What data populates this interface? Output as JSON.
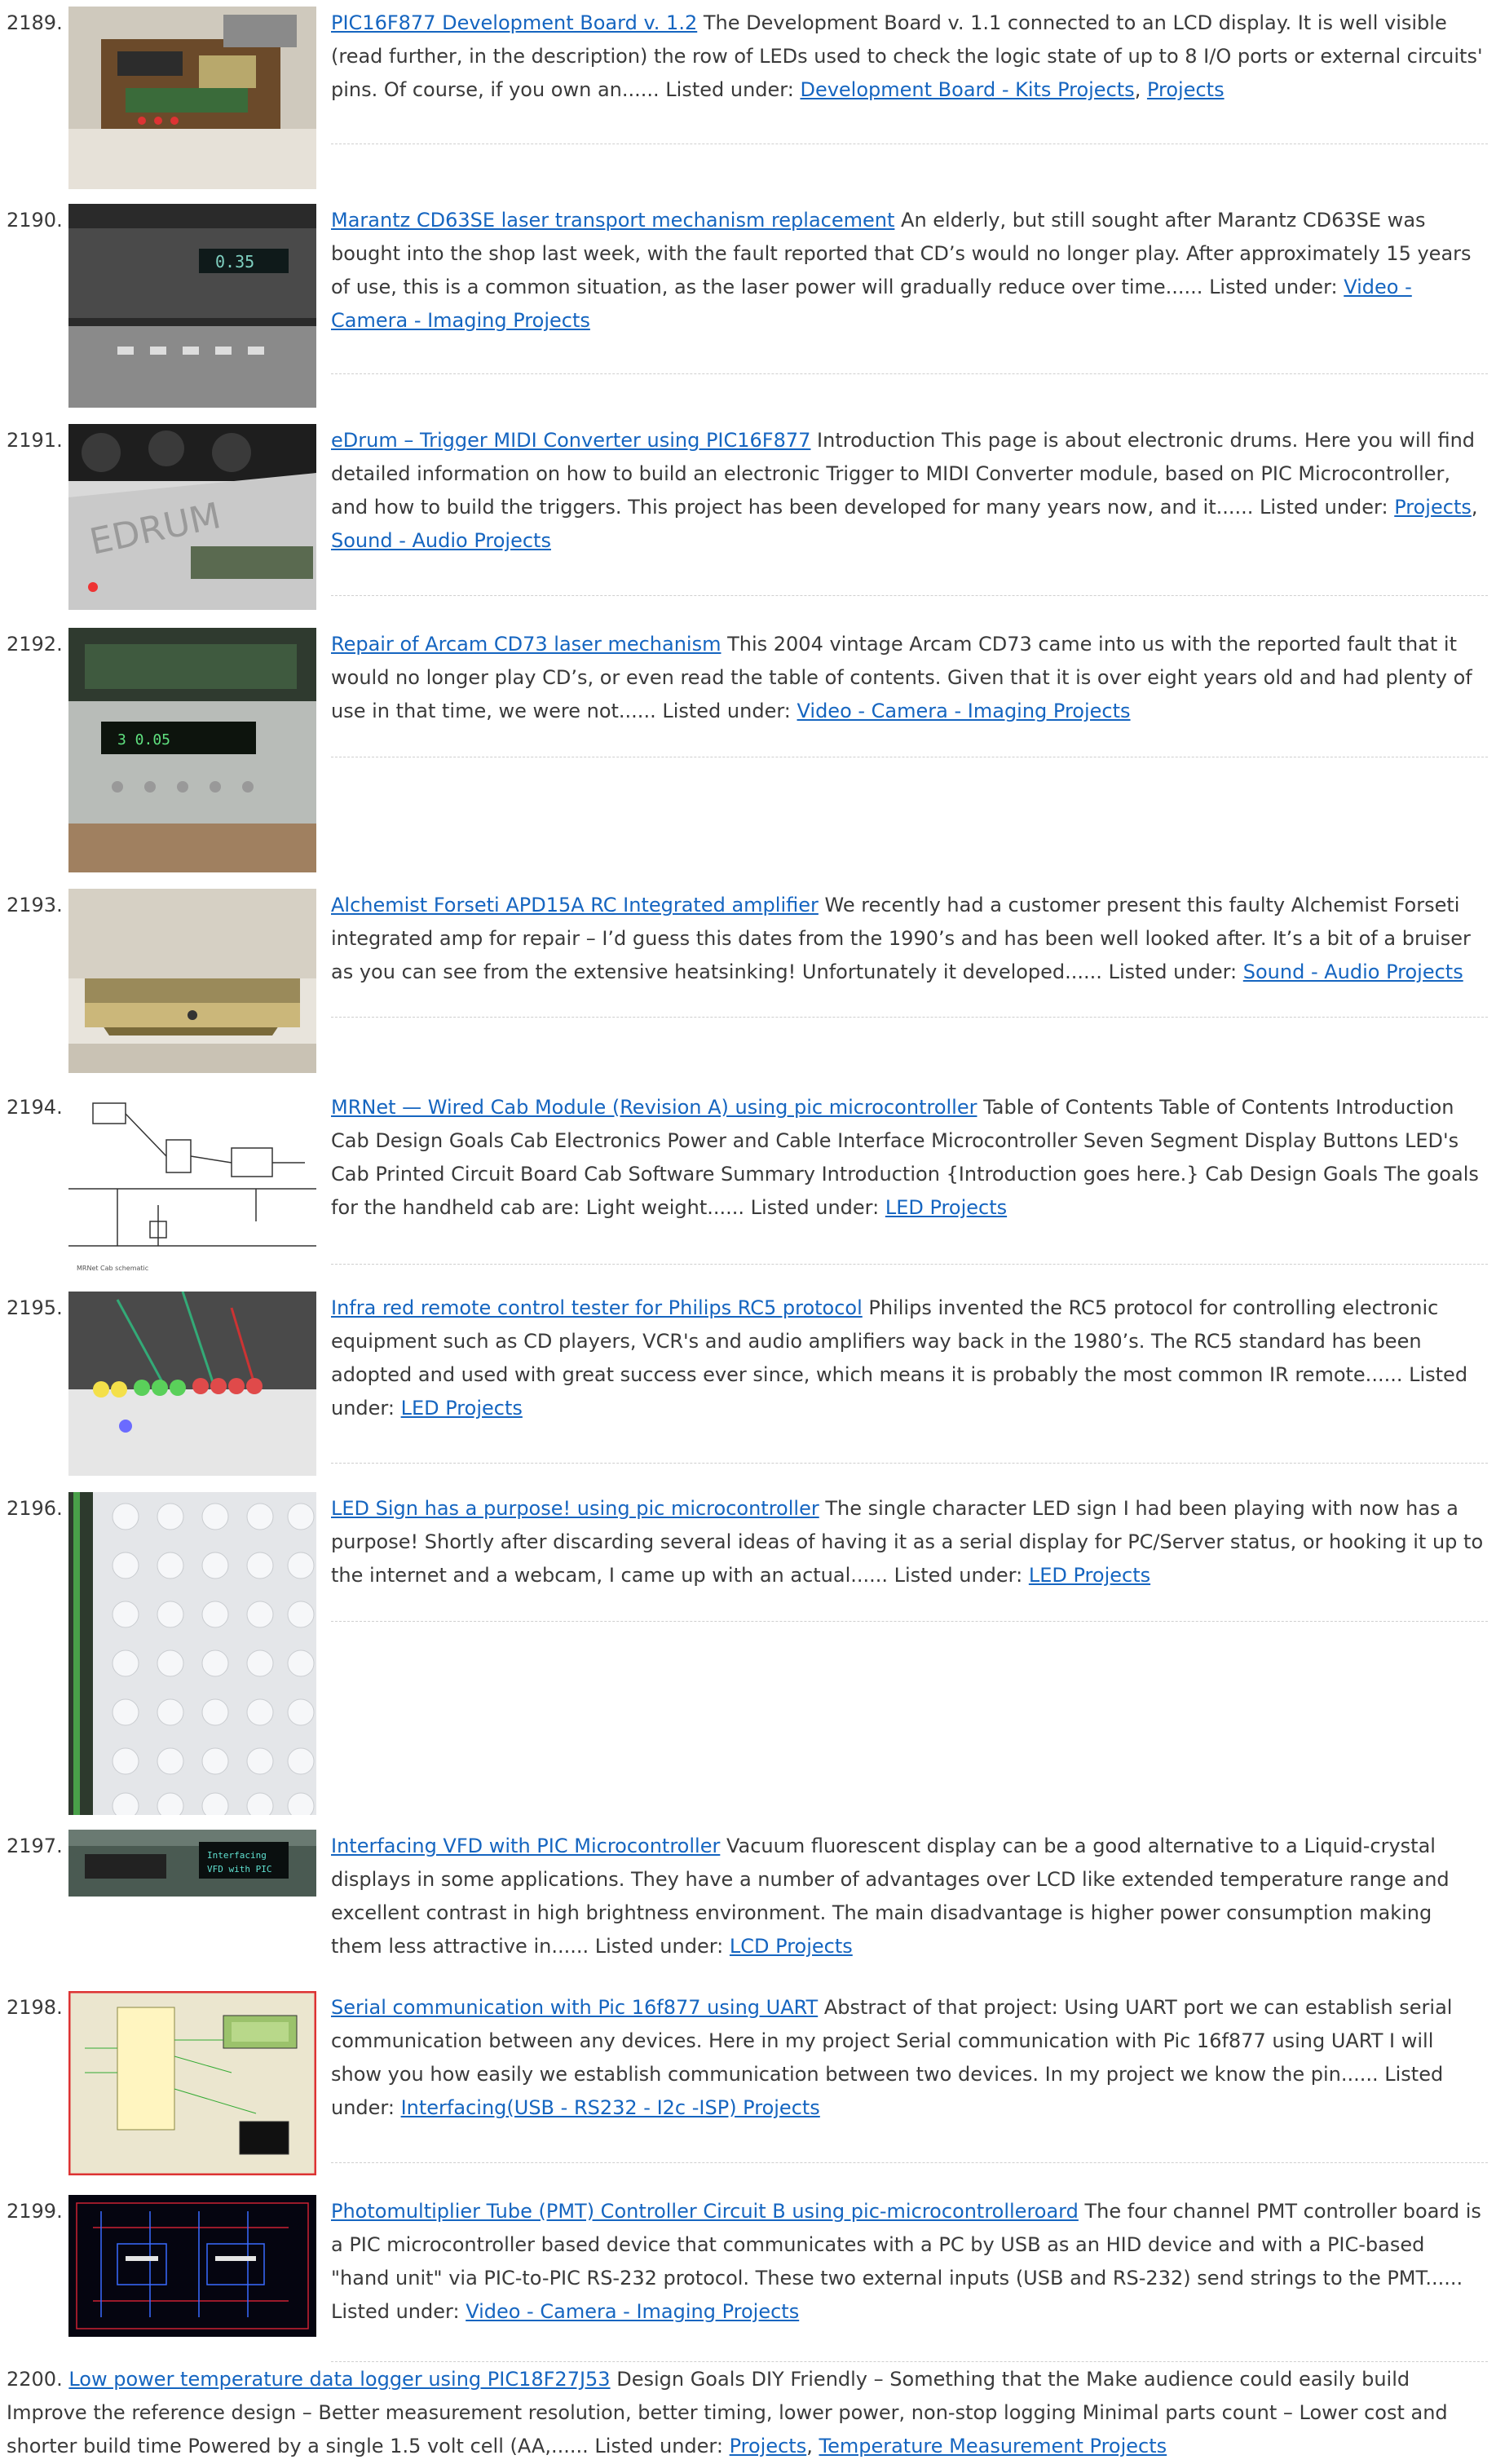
{
  "listed_under_label": "Listed under:",
  "items": [
    {
      "num": "2189.",
      "title": "PIC16F877 Development Board v. 1.2",
      "text": " The Development Board v. 1.1 connected to an LCD display. It is well visible (read further, in the description) the row of LEDs used to check the logic state of up to 8 I/O ports or external circuits' pins. Of course, if you own an...... ",
      "cats": [
        "Development Board - Kits Projects",
        "Projects"
      ],
      "thumb_icon": "circuit-board-photo"
    },
    {
      "num": "2190.",
      "title": "Marantz CD63SE laser transport mechanism replacement",
      "text": " An elderly, but still sought after Marantz CD63SE was bought into the shop last week, with the fault reported that CD’s would no longer play. After approximately 15 years of use, this is a common situation, as the laser power will gradually reduce over time...... ",
      "cats": [
        "Video - Camera - Imaging Projects"
      ],
      "thumb_icon": "cd-player-photo"
    },
    {
      "num": "2191.",
      "title": "eDrum – Trigger MIDI Converter using PIC16F877",
      "text": " Introduction This page is about electronic drums. Here you will find detailed information on how to build an electronic Trigger to MIDI Converter module, based on PIC Microcontroller, and how to build the triggers. This project has been developed for many years now, and it...... ",
      "cats": [
        "Projects",
        "Sound - Audio Projects"
      ],
      "thumb_icon": "edrum-device-photo"
    },
    {
      "num": "2192.",
      "title": "Repair of Arcam CD73 laser mechanism",
      "text": " This 2004 vintage Arcam CD73 came into us with the reported fault that it would no longer play CD’s, or even read the table of contents. Given that it is over eight years old and had plenty of use in that time, we were not...... ",
      "cats": [
        "Video - Camera - Imaging Projects"
      ],
      "thumb_icon": "cd-player-open-photo"
    },
    {
      "num": "2193.",
      "title": "Alchemist Forseti APD15A RC Integrated amplifier",
      "text": " We recently had a customer present this faulty Alchemist Forseti integrated amp for repair – I’d guess this dates from the 1990’s and has been well looked after. It’s a bit of a bruiser as you can see from the extensive heatsinking! Unfortunately it developed...... ",
      "cats": [
        "Sound - Audio Projects"
      ],
      "thumb_icon": "amplifier-photo"
    },
    {
      "num": "2194.",
      "title": "MRNet — Wired Cab Module (Revision A) using pic microcontroller",
      "text": " Table of Contents Table of Contents Introduction Cab Design Goals Cab Electronics Power and Cable Interface Microcontroller Seven Segment Display Buttons LED's Cab Printed Circuit Board Cab Software Summary  Introduction {Introduction goes here.} Cab Design Goals The goals for the handheld cab are: Light weight...... ",
      "cats": [
        "LED Projects"
      ],
      "thumb_icon": "schematic-diagram"
    },
    {
      "num": "2195.",
      "title": "Infra red remote control tester for Philips RC5 protocol",
      "text": " Philips invented the RC5 protocol for controlling electronic equipment such as CD players, VCR's and audio amplifiers way back in the 1980’s. The RC5 standard has been adopted and used with great success ever since, which means it is probably the most common IR remote...... ",
      "cats": [
        "LED Projects"
      ],
      "thumb_icon": "breadboard-leds-photo"
    },
    {
      "num": "2196.",
      "title": "LED Sign has a purpose! using pic microcontroller",
      "text": " The single character LED sign I had been playing with now has a purpose! Shortly after discarding several ideas of having it as a serial display for PC/Server status, or hooking it up to the internet and a webcam, I came up with an actual...... ",
      "cats": [
        "LED Projects"
      ],
      "thumb_icon": "led-matrix-photo"
    },
    {
      "num": "2197.",
      "title": "Interfacing VFD with PIC Microcontroller",
      "text": " Vacuum fluorescent display can be a good alternative to a Liquid-crystal displays in some applications. They have a number of advantages over LCD like extended temperature range and excellent contrast in high brightness environment. The main disadvantage is higher power consumption making them less attractive in...... ",
      "cats": [
        "LCD Projects"
      ],
      "thumb_icon": "vfd-display-photo"
    },
    {
      "num": "2198.",
      "title": "Serial communication with Pic 16f877 using UART",
      "text": " Abstract of that project: Using UART port we can establish serial communication between any devices. Here in my project Serial communication with Pic 16f877 using UART I will show you how easily we establish communication between two devices. In my project we know the pin...... ",
      "cats": [
        "Interfacing(USB - RS232 - I2c -ISP) Projects"
      ],
      "thumb_icon": "simulation-schematic"
    },
    {
      "num": "2199.",
      "title": "Photomultiplier Tube (PMT) Controller Circuit B using pic-microcontrolleroard",
      "text": " The four channel PMT controller board is a PIC microcontroller based device that communicates with a PC by USB as an HID device and with a PIC-based \"hand unit\" via PIC-to-PIC RS-232 protocol. These two external inputs (USB and RS-232) send strings to the PMT...... ",
      "cats": [
        "Video - Camera - Imaging Projects"
      ],
      "thumb_icon": "pcb-layout"
    },
    {
      "num": "2200.",
      "title": "Low power temperature data logger using PIC18F27J53",
      "text": " Design Goals DIY Friendly – Something that the Make audience could easily build Improve the reference design – Better measurement resolution, better timing, lower power, non-stop logging Minimal parts count – Lower cost and shorter build time Powered by a single 1.5 volt cell (AA,...... ",
      "cats": [
        "Projects",
        "Temperature Measurement Projects"
      ],
      "thumb_icon": ""
    }
  ]
}
